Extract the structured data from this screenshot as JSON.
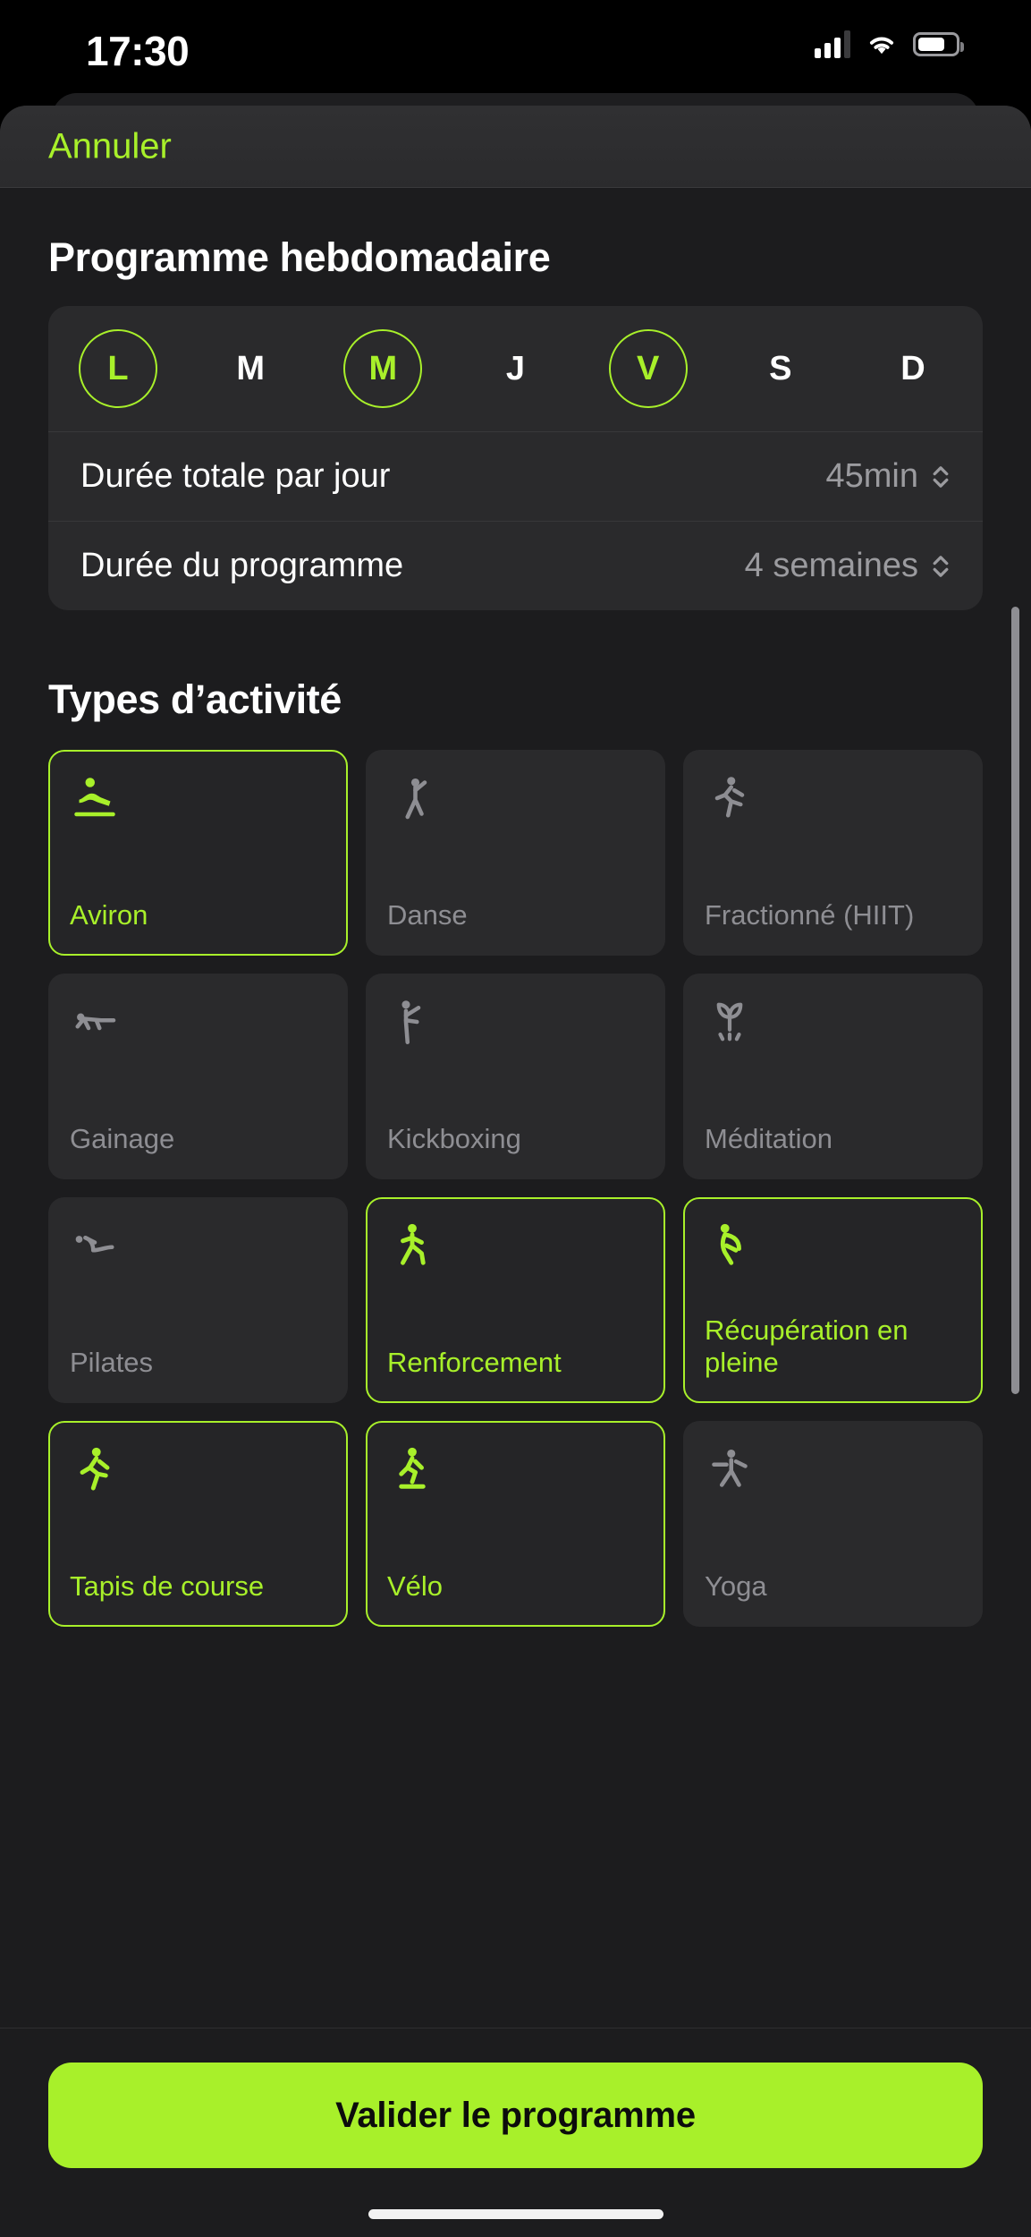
{
  "status_bar": {
    "time": "17:30",
    "signal_icon": "cellular-bars-icon",
    "wifi_icon": "wifi-icon",
    "battery_icon": "battery-icon"
  },
  "sheet_header": {
    "cancel_label": "Annuler"
  },
  "weekly": {
    "title": "Programme hebdomadaire",
    "days": [
      {
        "label": "L",
        "selected": true
      },
      {
        "label": "M",
        "selected": false
      },
      {
        "label": "M",
        "selected": true
      },
      {
        "label": "J",
        "selected": false
      },
      {
        "label": "V",
        "selected": true
      },
      {
        "label": "S",
        "selected": false
      },
      {
        "label": "D",
        "selected": false
      }
    ],
    "settings": [
      {
        "label": "Durée totale par jour",
        "value": "45min",
        "control": "stepper-chevron-icon"
      },
      {
        "label": "Durée du programme",
        "value": "4 semaines",
        "control": "stepper-chevron-icon"
      }
    ]
  },
  "activity": {
    "title": "Types d’activité",
    "tiles": [
      {
        "name": "Aviron",
        "icon": "rowing-icon",
        "selected": true
      },
      {
        "name": "Danse",
        "icon": "dance-icon",
        "selected": false
      },
      {
        "name": "Fractionné (HIIT)",
        "icon": "running-interval-icon",
        "selected": false
      },
      {
        "name": "Gainage",
        "icon": "plank-core-icon",
        "selected": false
      },
      {
        "name": "Kickboxing",
        "icon": "kickboxing-icon",
        "selected": false
      },
      {
        "name": "Méditation",
        "icon": "sprout-meditation-icon",
        "selected": false
      },
      {
        "name": "Pilates",
        "icon": "pilates-icon",
        "selected": false
      },
      {
        "name": "Renforcement",
        "icon": "strength-lunge-icon",
        "selected": true
      },
      {
        "name": "Récupération en pleine",
        "icon": "stretching-recovery-icon",
        "selected": true
      },
      {
        "name": "Tapis de course",
        "icon": "treadmill-run-icon",
        "selected": true
      },
      {
        "name": "Vélo",
        "icon": "cycling-icon",
        "selected": true
      },
      {
        "name": "Yoga",
        "icon": "yoga-icon",
        "selected": false
      }
    ]
  },
  "footer": {
    "submit_label": "Valider le programme"
  },
  "colors": {
    "accent": "#a8f02a",
    "sheet_bg": "#1c1c1e",
    "card_bg": "#2a2a2c",
    "muted_text": "#8e8e93"
  }
}
